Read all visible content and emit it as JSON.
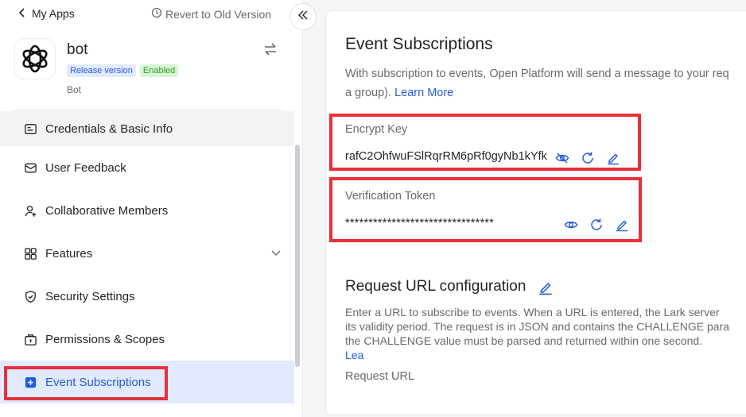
{
  "nav_back": {
    "label": "My Apps"
  },
  "revert": {
    "label": "Revert to Old Version"
  },
  "app": {
    "name": "bot",
    "release_badge": "Release version",
    "enabled_badge": "Enabled",
    "type": "Bot"
  },
  "sidebar": {
    "items": [
      {
        "label": "Credentials & Basic Info",
        "icon": "id-card-icon"
      },
      {
        "label": "User Feedback",
        "icon": "mail-icon"
      },
      {
        "label": "Collaborative Members",
        "icon": "user-add-icon"
      },
      {
        "label": "Features",
        "icon": "grid-icon"
      },
      {
        "label": "Security Settings",
        "icon": "shield-icon"
      },
      {
        "label": "Permissions & Scopes",
        "icon": "lock-box-icon"
      },
      {
        "label": "Event Subscriptions",
        "icon": "event-icon"
      }
    ]
  },
  "main": {
    "title": "Event Subscriptions",
    "desc_line1": "With subscription to events, Open Platform will send a message to your req",
    "desc_line2": "a group). ",
    "learn_more": "Learn More",
    "encrypt": {
      "label": "Encrypt Key",
      "value": "rafC2OhfwuFSlRqrRM6pRf0gyNb1kYfk"
    },
    "verification": {
      "label": "Verification Token",
      "value": "********************************"
    },
    "request_url": {
      "title": "Request URL configuration",
      "line1": "Enter a URL to subscribe to events. When a URL is entered, the Lark server",
      "line2": "its validity period. The request is in JSON and contains the CHALLENGE para",
      "line3": "the CHALLENGE value must be parsed and returned within one second. ",
      "line3_link": "Lea",
      "field_label": "Request URL"
    }
  },
  "colors": {
    "accent": "#245bdb",
    "highlight": "#e8303a",
    "active_bg": "#e1eaff"
  }
}
